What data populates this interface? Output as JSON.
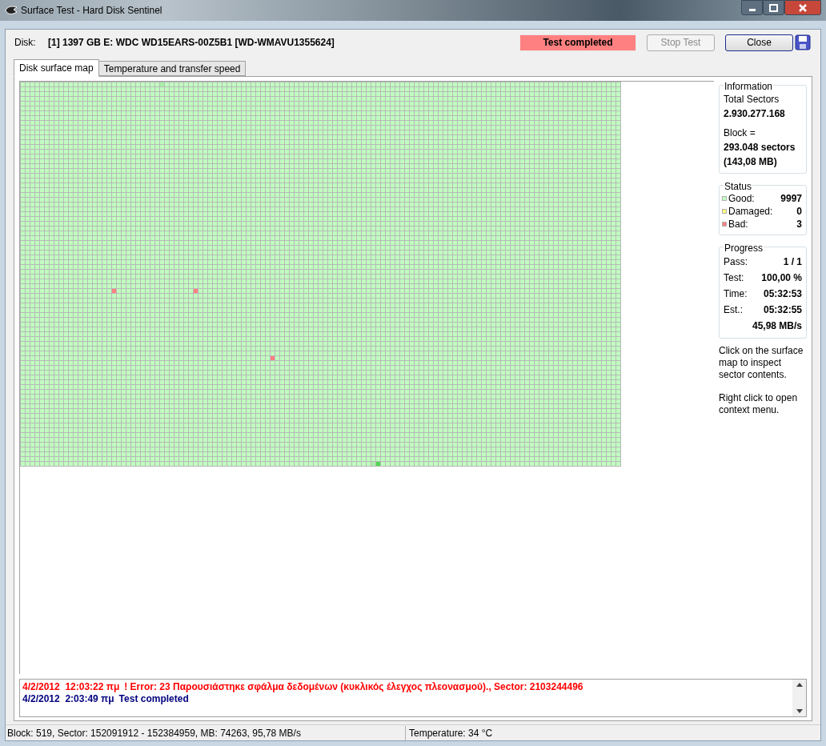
{
  "window": {
    "title": "Surface Test - Hard Disk Sentinel"
  },
  "toolbar": {
    "disk_label": "Disk:",
    "disk_value": "[1] 1397 GB E: WDC WD15EARS-00Z5B1 [WD-WMAVU1355624]",
    "status": "Test completed",
    "buttons": [
      {
        "label": "Stop Test",
        "disabled": true
      },
      {
        "label": "Close",
        "disabled": false
      }
    ]
  },
  "tabs": [
    {
      "label": "Disk surface map",
      "selected": true
    },
    {
      "label": "Temperature and transfer speed",
      "selected": false
    }
  ],
  "information": {
    "title": "Information",
    "total_label": "Total Sectors",
    "total_value": "2.930.277.168",
    "block_label": "Block =",
    "block_value": "293.048 sectors",
    "block_size": "(143,08 MB)"
  },
  "status": {
    "title": "Status",
    "items": [
      {
        "label": "Good:",
        "value": "9997",
        "color": "#c0ffc0"
      },
      {
        "label": "Damaged:",
        "value": "0",
        "color": "#ffff80"
      },
      {
        "label": "Bad:",
        "value": "3",
        "color": "#ff8080"
      }
    ]
  },
  "progress": {
    "title": "Progress",
    "rows": [
      {
        "label": "Pass:",
        "value": "1 / 1"
      },
      {
        "label": "Test:",
        "value": "100,00 %"
      },
      {
        "label": "Time:",
        "value": "05:32:53"
      },
      {
        "label": "Est.:",
        "value": "05:32:55"
      },
      {
        "label": "",
        "value": "45,98 MB/s"
      }
    ]
  },
  "hints": [
    "Click on the surface map to inspect sector contents.",
    "Right click to open context menu."
  ],
  "log": [
    {
      "kind": "error",
      "time": "4/2/2012  12:03:22 πμ",
      "text": "! Error: 23 Παρουσιάστηκε σφάλμα δεδομένων (κυκλικός έλεγχος πλεονασμού)., Sector: 2103244496"
    },
    {
      "kind": "info",
      "time": "4/2/2012  2:03:49 πμ",
      "text": "Test completed"
    }
  ],
  "status_bar": {
    "block": "Block: 519, Sector: 152091912 - 152384959, MB: 74263, 95,78 MB/s",
    "temperature": "Temperature: 34  °C"
  }
}
